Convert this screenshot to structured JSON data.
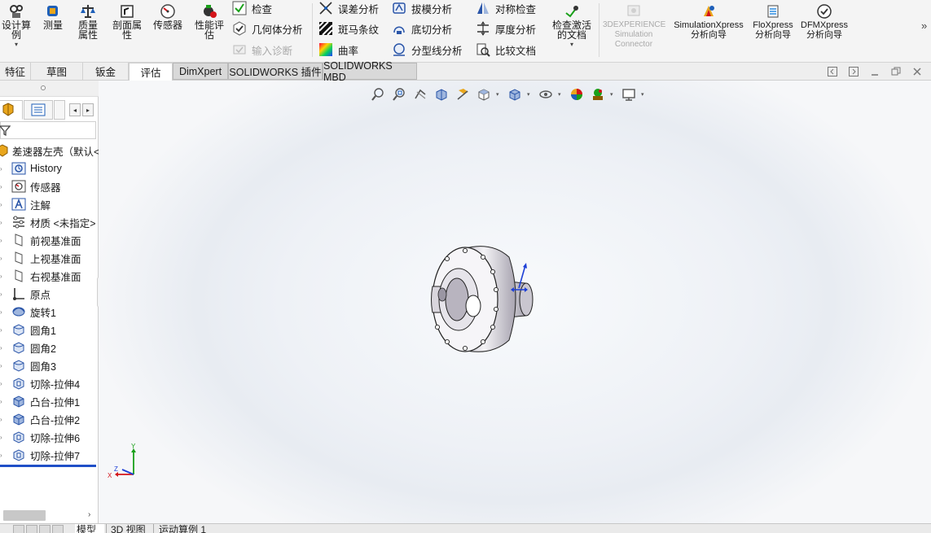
{
  "ribbon": {
    "large_buttons": [
      {
        "label": "设计算例",
        "icon": "design-study-icon"
      },
      {
        "label": "测量",
        "icon": "measure-icon"
      },
      {
        "label": "质量属性",
        "icon": "mass-properties-icon"
      },
      {
        "label": "剖面属性",
        "icon": "section-properties-icon"
      },
      {
        "label": "传感器",
        "icon": "sensor-icon"
      },
      {
        "label": "性能评估",
        "icon": "performance-evaluation-icon"
      }
    ],
    "col1": [
      {
        "label": "检查",
        "icon": "check-icon",
        "disabled": false
      },
      {
        "label": "几何体分析",
        "icon": "geometry-analysis-icon",
        "disabled": false
      },
      {
        "label": "输入诊断",
        "icon": "import-diagnostics-icon",
        "disabled": true
      }
    ],
    "col2": [
      {
        "label": "误差分析",
        "icon": "deviation-analysis-icon"
      },
      {
        "label": "斑马条纹",
        "icon": "zebra-stripes-icon"
      },
      {
        "label": "曲率",
        "icon": "curvature-icon"
      }
    ],
    "col3": [
      {
        "label": "拔模分析",
        "icon": "draft-analysis-icon"
      },
      {
        "label": "底切分析",
        "icon": "undercut-analysis-icon"
      },
      {
        "label": "分型线分析",
        "icon": "parting-line-analysis-icon"
      }
    ],
    "col4": [
      {
        "label": "对称检查",
        "icon": "symmetry-check-icon"
      },
      {
        "label": "厚度分析",
        "icon": "thickness-analysis-icon"
      },
      {
        "label": "比较文档",
        "icon": "compare-documents-icon"
      }
    ],
    "check_active_doc": {
      "label": "检查激活的文档",
      "icon": "check-active-document-icon"
    },
    "addins": [
      {
        "label": "3DEXPERIENCE Simulation Connector",
        "icon": "3dexperience-icon",
        "disabled": true
      },
      {
        "label": "SimulationXpress 分析向导",
        "icon": "simulationxpress-icon",
        "disabled": false
      },
      {
        "label": "FloXpress 分析向导",
        "icon": "floxpress-icon",
        "disabled": false
      },
      {
        "label": "DFMXpress 分析向导",
        "icon": "dfmxpress-icon",
        "disabled": false
      }
    ]
  },
  "tabs": [
    {
      "label": "特征",
      "active": false
    },
    {
      "label": "草图",
      "active": false
    },
    {
      "label": "钣金",
      "active": false
    },
    {
      "label": "评估",
      "active": true
    },
    {
      "label": "DimXpert",
      "active": false
    },
    {
      "label": "SOLIDWORKS 插件",
      "active": false
    },
    {
      "label": "SOLIDWORKS MBD",
      "active": false
    }
  ],
  "feature_tree": {
    "root": {
      "label": "差速器左壳（默认<",
      "icon": "part-icon"
    },
    "items": [
      {
        "label": "History",
        "icon": "history-folder-icon"
      },
      {
        "label": "传感器",
        "icon": "sensor-folder-icon"
      },
      {
        "label": "注解",
        "icon": "annotations-icon"
      },
      {
        "label": "材质 <未指定>",
        "icon": "material-icon"
      },
      {
        "label": "前视基准面",
        "icon": "plane-icon"
      },
      {
        "label": "上视基准面",
        "icon": "plane-icon"
      },
      {
        "label": "右视基准面",
        "icon": "plane-icon"
      },
      {
        "label": "原点",
        "icon": "origin-icon"
      },
      {
        "label": "旋转1",
        "icon": "revolve-icon"
      },
      {
        "label": "圆角1",
        "icon": "fillet-icon"
      },
      {
        "label": "圆角2",
        "icon": "fillet-icon"
      },
      {
        "label": "圆角3",
        "icon": "fillet-icon"
      },
      {
        "label": "切除-拉伸4",
        "icon": "cut-extrude-icon"
      },
      {
        "label": "凸台-拉伸1",
        "icon": "boss-extrude-icon"
      },
      {
        "label": "凸台-拉伸2",
        "icon": "boss-extrude-icon"
      },
      {
        "label": "切除-拉伸6",
        "icon": "cut-extrude-icon"
      },
      {
        "label": "切除-拉伸7",
        "icon": "cut-extrude-icon"
      }
    ]
  },
  "triad": {
    "x_label": "X",
    "y_label": "Y",
    "z_label": "Z"
  },
  "bottom_tabs": [
    {
      "label": "模型",
      "active": true
    },
    {
      "label": "3D 视图",
      "active": false
    },
    {
      "label": "运动算例 1",
      "active": false
    }
  ],
  "colors": {
    "accent": "#1f4fc7",
    "axis_x": "#d4141a",
    "axis_y": "#19a019",
    "axis_z": "#1d3fd6"
  }
}
